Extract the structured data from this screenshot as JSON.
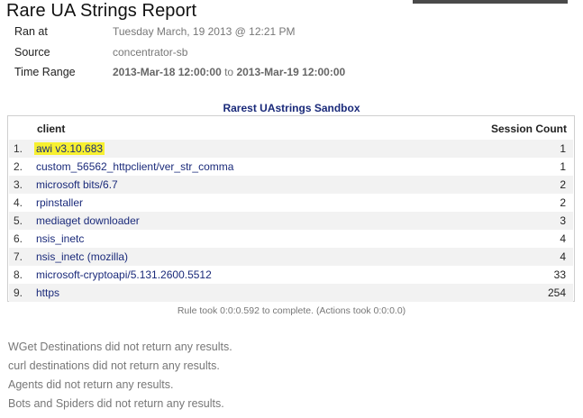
{
  "report": {
    "title": "Rare UA Strings Report"
  },
  "meta": {
    "ran_at_label": "Ran at",
    "ran_at_value": "Tuesday March, 19 2013 @ 12:21 PM",
    "source_label": "Source",
    "source_value": "concentrator-sb",
    "time_range_label": "Time Range",
    "time_range_start": "2013-Mar-18 12:00:00",
    "time_range_to": "to",
    "time_range_end": "2013-Mar-19 12:00:00"
  },
  "section": {
    "title": "Rarest UAstrings Sandbox",
    "columns": {
      "client": "client",
      "count": "Session Count"
    },
    "rows": [
      {
        "idx": "1.",
        "client": "awi v3.10.683",
        "count": "1",
        "highlighted": true
      },
      {
        "idx": "2.",
        "client": "custom_56562_httpclient/ver_str_comma",
        "count": "1"
      },
      {
        "idx": "3.",
        "client": "microsoft bits/6.7",
        "count": "2"
      },
      {
        "idx": "4.",
        "client": "rpinstaller",
        "count": "2"
      },
      {
        "idx": "5.",
        "client": "mediaget downloader",
        "count": "3"
      },
      {
        "idx": "6.",
        "client": "nsis_inetc",
        "count": "4"
      },
      {
        "idx": "7.",
        "client": "nsis_inetc (mozilla)",
        "count": "4"
      },
      {
        "idx": "8.",
        "client": "microsoft-cryptoapi/5.131.2600.5512",
        "count": "33"
      },
      {
        "idx": "9.",
        "client": "https",
        "count": "254"
      }
    ],
    "rule_note": "Rule took 0:0:0.592 to complete. (Actions took 0:0:0.0)"
  },
  "messages": [
    "WGet Destinations did not return any results.",
    "curl destinations did not return any results.",
    "Agents did not return any results.",
    "Bots and Spiders did not return any results."
  ],
  "colors": {
    "link": "#1a2a7a",
    "highlight": "#f7f030",
    "row_alt": "#f2f2f2"
  }
}
